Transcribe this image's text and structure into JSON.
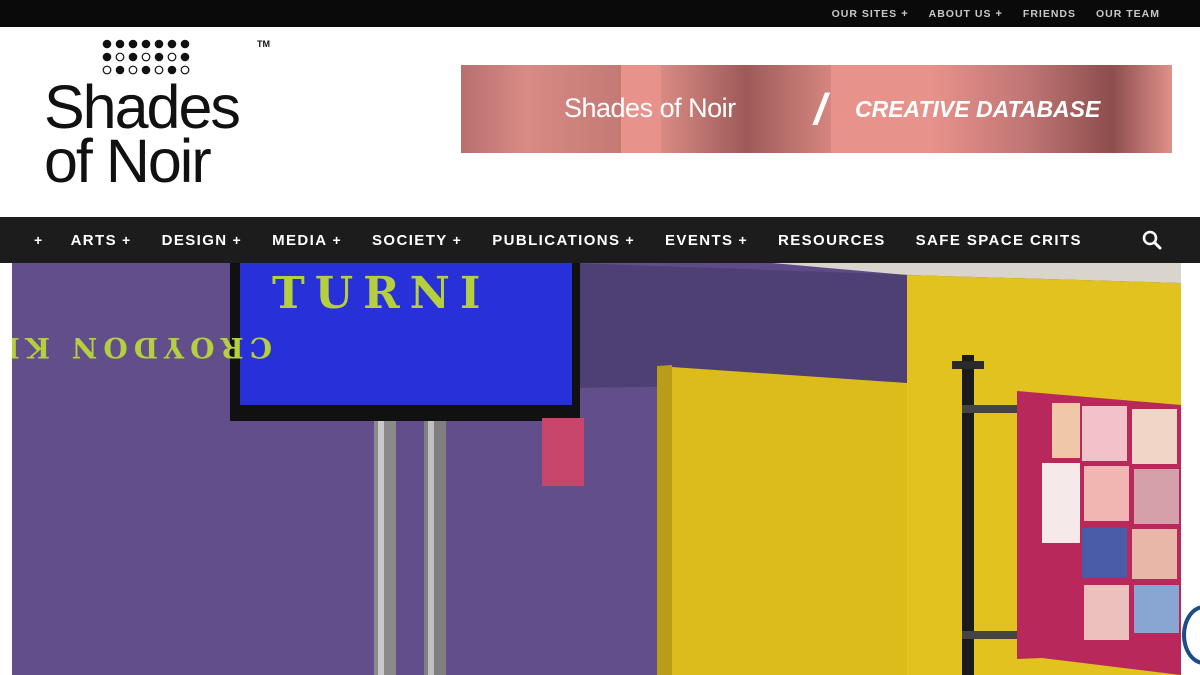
{
  "topbar": {
    "links": [
      {
        "label": "OUR SITES",
        "plus": "+"
      },
      {
        "label": "ABOUT US",
        "plus": "+"
      },
      {
        "label": "FRIENDS",
        "plus": ""
      },
      {
        "label": "OUR TEAM",
        "plus": ""
      }
    ]
  },
  "logo": {
    "line1": "Shades",
    "line2": "of Noir",
    "tm": "TM"
  },
  "banner": {
    "title": "Shades of Noir",
    "slash": "/",
    "subtitle": "CREATIVE DATABASE"
  },
  "nav": {
    "lead_plus": "+",
    "items": [
      {
        "label": "ARTS",
        "plus": "+"
      },
      {
        "label": "DESIGN",
        "plus": "+"
      },
      {
        "label": "MEDIA",
        "plus": "+"
      },
      {
        "label": "SOCIETY",
        "plus": "+"
      },
      {
        "label": "PUBLICATIONS",
        "plus": "+"
      },
      {
        "label": "EVENTS",
        "plus": "+"
      },
      {
        "label": "RESOURCES",
        "plus": ""
      },
      {
        "label": "SAFE SPACE CRITS",
        "plus": ""
      }
    ],
    "search_icon": "search-icon"
  },
  "hero": {
    "screen_text_1": "TURNI",
    "screen_text_2": "CROYDON KEE"
  },
  "colors": {
    "topbar": "#0a0a0a",
    "nav": "#1c1c1c",
    "banner": "#e8928c",
    "wall_purple": "#5d4a86",
    "wall_yellow": "#e2c21e",
    "screen_blue": "#2830d8",
    "screen_text": "#b5cf3e"
  }
}
